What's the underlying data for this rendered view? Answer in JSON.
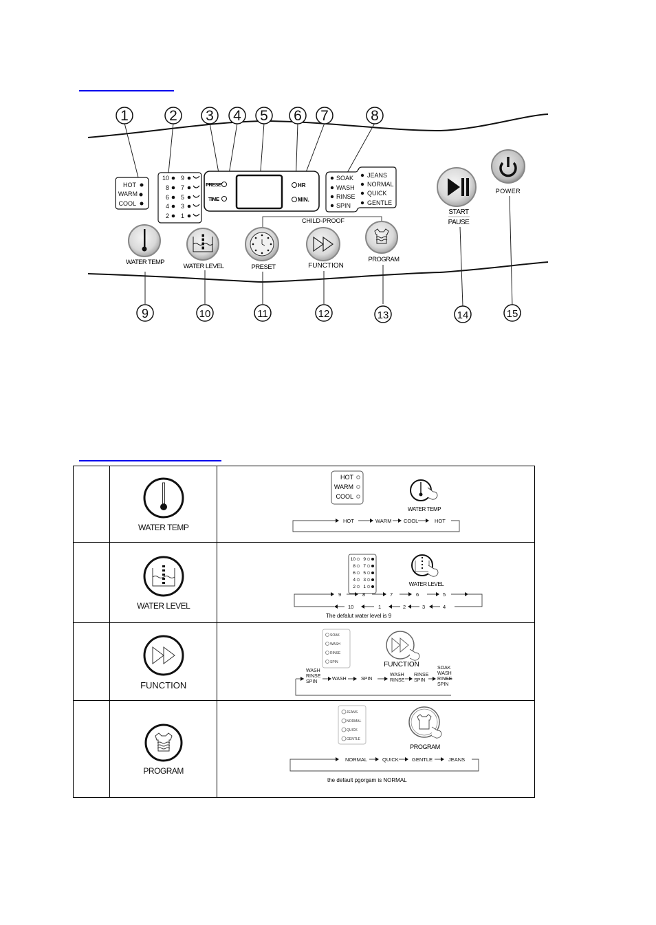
{
  "section_links": {
    "panel_heading": "",
    "functions_heading": ""
  },
  "panel": {
    "callouts": [
      "1",
      "2",
      "3",
      "4",
      "5",
      "6",
      "7",
      "8",
      "9",
      "10",
      "11",
      "12",
      "13",
      "14",
      "15"
    ],
    "temp_indicator": [
      "HOT",
      "WARM",
      "COOL"
    ],
    "level_indicator": {
      "left": [
        "10",
        "8",
        "6",
        "4",
        "2"
      ],
      "right": [
        "9",
        "7",
        "5",
        "3",
        "1"
      ]
    },
    "display_labels": {
      "preset": "PRESET",
      "time": "TIME",
      "hr": "HR",
      "min": "MIN."
    },
    "function_list": [
      "SOAK",
      "WASH",
      "RINSE",
      "SPIN"
    ],
    "program_list": [
      "JEANS",
      "NORMAL",
      "QUICK",
      "GENTLE"
    ],
    "child_proof": "CHILD-PROOF",
    "buttons": {
      "water_temp": "WATER TEMP",
      "water_level": "WATER LEVEL",
      "preset": "PRESET",
      "function": "FUNCTION",
      "program": "PROGRAM",
      "start": "START",
      "pause": "PAUSE",
      "power": "POWER"
    }
  },
  "table": {
    "rows": [
      {
        "number": "",
        "icon": "thermometer-icon",
        "label": "WATER TEMP",
        "indicator": [
          "HOT",
          "WARM",
          "COOL"
        ],
        "button_label": "WATER TEMP",
        "sequence": [
          "HOT",
          "WARM",
          "COOL",
          "HOT"
        ]
      },
      {
        "number": "",
        "icon": "water-level-icon",
        "label": "WATER LEVEL",
        "indicator_left": [
          "10",
          "8",
          "6",
          "4",
          "2"
        ],
        "indicator_right": [
          "9",
          "7",
          "5",
          "3",
          "1"
        ],
        "button_label": "WATER LEVEL",
        "sequence_top": [
          "9",
          "8",
          "7",
          "6",
          "5"
        ],
        "sequence_bottom": [
          "10",
          "1",
          "2",
          "3",
          "4"
        ],
        "note": "The defalut water level is 9"
      },
      {
        "number": "",
        "icon": "fast-forward-icon",
        "label": "FUNCTION",
        "indicator": [
          "SOAK",
          "WASH",
          "RINSE",
          "SPIN"
        ],
        "button_label": "FUNCTION",
        "sequence": [
          [
            "WASH",
            "RINSE",
            "SPIN"
          ],
          [
            "WASH"
          ],
          [
            "SPIN"
          ],
          [
            "WASH",
            "RINSE"
          ],
          [
            "RINSE",
            "SPIN"
          ],
          [
            "SOAK",
            "WASH",
            "RINSE",
            "SPIN"
          ]
        ]
      },
      {
        "number": "",
        "icon": "shirt-wash-icon",
        "label": "PROGRAM",
        "indicator": [
          "JEANS",
          "NORMAL",
          "QUICK",
          "GENTLE"
        ],
        "button_label": "PROGRAM",
        "sequence": [
          "NORMAL",
          "QUICK",
          "GENTLE",
          "JEANS"
        ],
        "note": "the default pgorgam is NORMAL"
      }
    ]
  }
}
